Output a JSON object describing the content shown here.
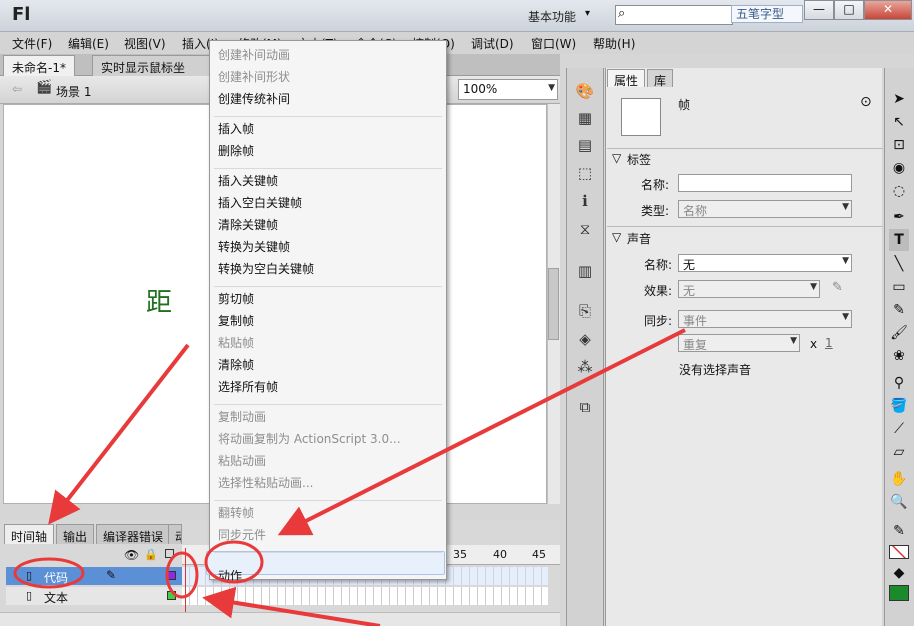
{
  "app": {
    "logo": "Fl",
    "workspace": "基本功能",
    "search_placeholder": "",
    "ime_label": "五笔字型"
  },
  "window_buttons": {
    "minimize": "—",
    "maximize": "□",
    "close": "✕"
  },
  "menubar": [
    "文件(F)",
    "编辑(E)",
    "视图(V)",
    "插入(I)",
    "修改(M)",
    "文本(T)",
    "命令(C)",
    "控制(O)",
    "调试(D)",
    "窗口(W)",
    "帮助(H)"
  ],
  "doc_tabs": [
    "未命名-1*",
    "实时显示鼠标坐"
  ],
  "scene": {
    "label": "场景 1",
    "zoom": "100%"
  },
  "stage_text": "距",
  "timeline": {
    "tabs": [
      "时间轴",
      "输出",
      "编译器错误",
      "动"
    ],
    "ruler": [
      "35",
      "40",
      "45"
    ],
    "layers": [
      {
        "name": "代码",
        "selected": true
      },
      {
        "name": "文本",
        "selected": false
      }
    ]
  },
  "context_menu": [
    {
      "label": "创建补间动画",
      "disabled": true
    },
    {
      "label": "创建补间形状",
      "disabled": true
    },
    {
      "label": "创建传统补间",
      "disabled": false
    },
    {
      "sep": true
    },
    {
      "label": "插入帧",
      "disabled": false
    },
    {
      "label": "删除帧",
      "disabled": false
    },
    {
      "sep": true
    },
    {
      "label": "插入关键帧",
      "disabled": false
    },
    {
      "label": "插入空白关键帧",
      "disabled": false
    },
    {
      "label": "清除关键帧",
      "disabled": false
    },
    {
      "label": "转换为关键帧",
      "disabled": false
    },
    {
      "label": "转换为空白关键帧",
      "disabled": false
    },
    {
      "sep": true
    },
    {
      "label": "剪切帧",
      "disabled": false
    },
    {
      "label": "复制帧",
      "disabled": false
    },
    {
      "label": "粘贴帧",
      "disabled": true
    },
    {
      "label": "清除帧",
      "disabled": false
    },
    {
      "label": "选择所有帧",
      "disabled": false
    },
    {
      "sep": true
    },
    {
      "label": "复制动画",
      "disabled": true
    },
    {
      "label": "将动画复制为 ActionScript 3.0...",
      "disabled": true
    },
    {
      "label": "粘贴动画",
      "disabled": true
    },
    {
      "label": "选择性粘贴动画...",
      "disabled": true
    },
    {
      "sep": true
    },
    {
      "label": "翻转帧",
      "disabled": true
    },
    {
      "label": "同步元件",
      "disabled": true
    },
    {
      "sep": true
    },
    {
      "label": "动作",
      "disabled": false,
      "highlight": true
    }
  ],
  "properties": {
    "tabs": [
      "属性",
      "库"
    ],
    "header": "帧",
    "section_label": "标签",
    "name_label": "名称:",
    "name_value": "",
    "type_label": "类型:",
    "type_value": "名称",
    "section_sound": "声音",
    "sound_name_label": "名称:",
    "sound_name_value": "无",
    "effect_label": "效果:",
    "effect_value": "无",
    "sync_label": "同步:",
    "sync_value": "事件",
    "repeat_value": "重复",
    "repeat_x": "x",
    "repeat_count": "1",
    "no_sound": "没有选择声音"
  },
  "annotation_color": "#e83a3a"
}
